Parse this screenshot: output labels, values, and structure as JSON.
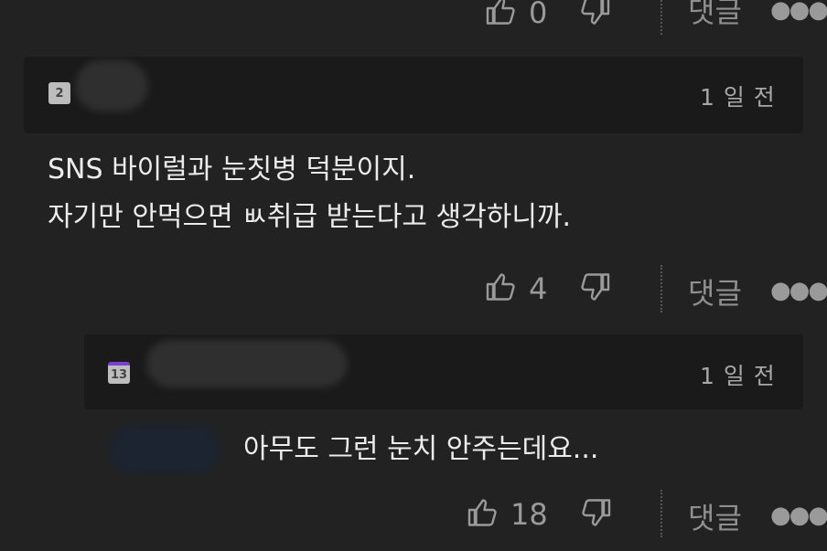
{
  "comments": [
    {
      "likes": "0",
      "reply_label": "댓글",
      "more_label": "●●●"
    },
    {
      "level_badge": "2",
      "time": "1 일 전",
      "lines": [
        "SNS 바이럴과 눈칫병 덕분이지.",
        "자기만 안먹으면 ㅄ취급 받는다고 생각하니까."
      ],
      "likes": "4",
      "reply_label": "댓글",
      "more_label": "●●●"
    },
    {
      "level_badge": "13",
      "time": "1 일 전",
      "text": "아무도 그런 눈치 안주는데요...",
      "likes": "18",
      "reply_label": "댓글",
      "more_label": "●●●"
    }
  ],
  "icons": {
    "like": "thumbs-up-icon",
    "dislike": "thumbs-down-icon",
    "more": "more-dots-icon"
  }
}
